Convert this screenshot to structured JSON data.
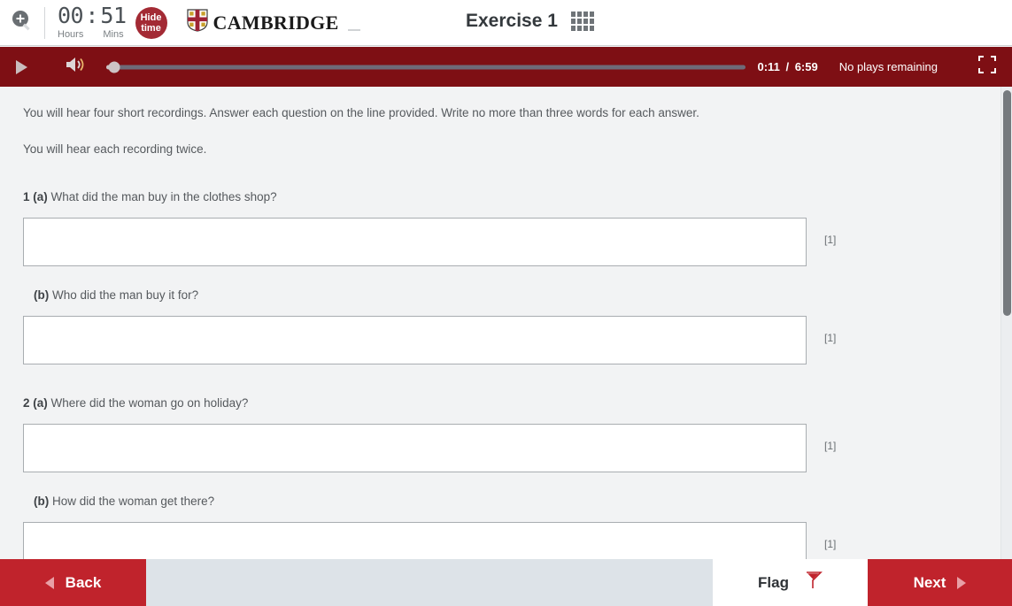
{
  "header": {
    "zoom_icon": "magnifier-plus-icon",
    "timer": {
      "hours_value": "00",
      "hours_unit": "Hours",
      "separator": ":",
      "mins_value": "51",
      "mins_unit": "Mins"
    },
    "hide_time_line1": "Hide",
    "hide_time_line2": "time",
    "brand_name": "CAMBRIDGE",
    "brand_crest": "cambridge-crest-icon",
    "exercise_title": "Exercise 1",
    "grid_icon": "grid-menu-icon"
  },
  "player": {
    "play_icon": "play-icon",
    "volume_icon": "volume-icon",
    "current_time": "0:11",
    "separator": "/",
    "total_time": "6:59",
    "plays_remaining": "No plays remaining",
    "fullscreen_icon": "fullscreen-icon",
    "background_color": "#7e0f14"
  },
  "content": {
    "instructions": [
      "You will hear four short recordings. Answer each question on the line provided. Write no more than three words for each answer.",
      "You will hear each recording twice."
    ],
    "questions": [
      {
        "number": "1 (a)",
        "text": "What did the man buy in the clothes shop?",
        "mark": "[1]",
        "indent": false
      },
      {
        "number": "(b)",
        "text": "Who did the man buy it for?",
        "mark": "[1]",
        "indent": true
      },
      {
        "number": "2 (a)",
        "text": "Where did the woman go on holiday?",
        "mark": "[1]",
        "indent": false
      },
      {
        "number": "(b)",
        "text": "How did the woman get there?",
        "mark": "[1]",
        "indent": true
      }
    ]
  },
  "bottom_nav": {
    "back_label": "Back",
    "back_icon": "chevron-left-icon",
    "flag_label": "Flag",
    "flag_icon": "flag-icon",
    "next_label": "Next",
    "next_icon": "chevron-right-icon",
    "accent_color": "#c0232c"
  }
}
